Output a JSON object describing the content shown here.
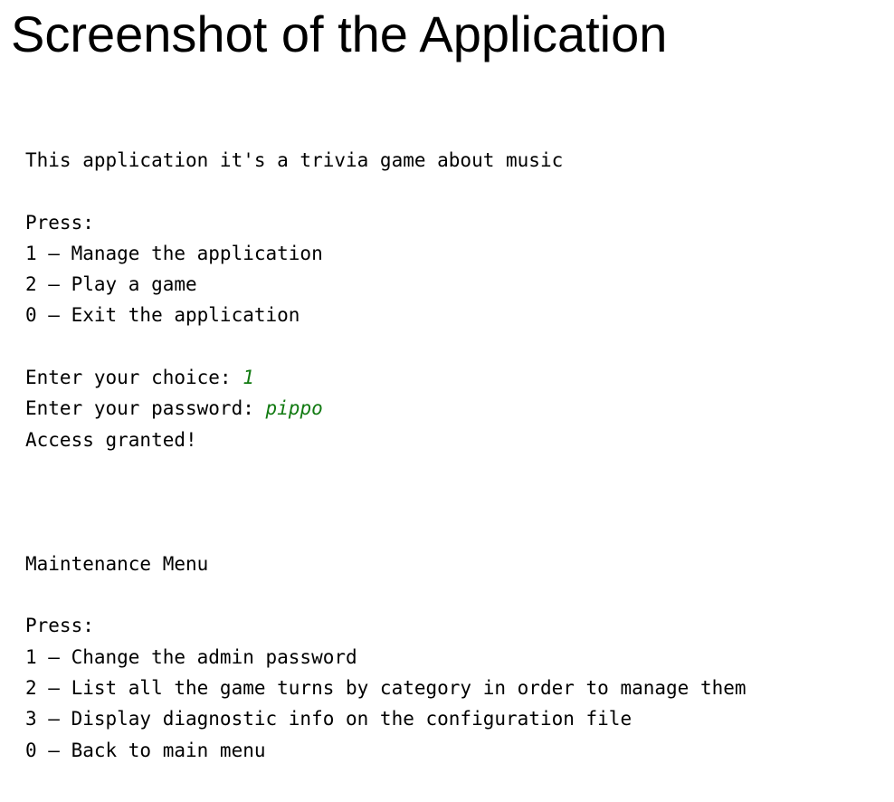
{
  "page": {
    "heading": "Screenshot of the Application"
  },
  "colors": {
    "user_input": "#117a11",
    "text": "#000000",
    "background": "#ffffff"
  },
  "terminal": {
    "intro": "This application it's a trivia game about music",
    "main_menu": {
      "press_label": "Press:",
      "options": [
        "1 – Manage the application",
        "2 – Play a game",
        "0 – Exit the application"
      ]
    },
    "prompts": {
      "choice_label": "Enter your choice: ",
      "choice_value": "1",
      "password_label": "Enter your password: ",
      "password_value": "pippo",
      "result": "Access granted!"
    },
    "maintenance_menu": {
      "title": "Maintenance Menu",
      "press_label": "Press:",
      "options": [
        "1 – Change the admin password",
        "2 – List all the game turns by category in order to manage them",
        "3 – Display diagnostic info on the configuration file",
        "0 – Back to main menu"
      ]
    }
  }
}
